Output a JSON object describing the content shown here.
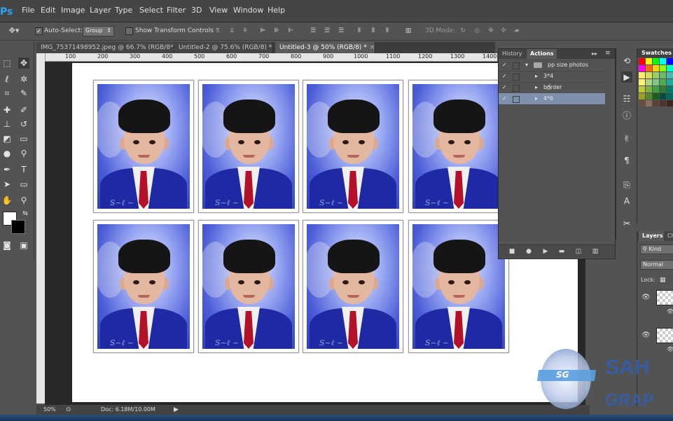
{
  "app": {
    "logo": "Ps"
  },
  "menu": [
    "File",
    "Edit",
    "Image",
    "Layer",
    "Type",
    "Select",
    "Filter",
    "3D",
    "View",
    "Window",
    "Help"
  ],
  "options": {
    "auto_select_label": "Auto-Select:",
    "auto_select_value": "Group",
    "show_transform_label": "Show Transform Controls",
    "mode_3d_label": "3D Mode:"
  },
  "tabs": [
    {
      "label": "IMG_75371498952.jpeg @ 66.7% (RGB/8*)"
    },
    {
      "label": "Untitled-2 @ 75.6% (RGB/8) *"
    },
    {
      "label": "Untitled-3 @ 50% (RGB/8) *"
    }
  ],
  "ruler": [
    "100",
    "200",
    "300",
    "400",
    "500",
    "600",
    "700",
    "800",
    "900",
    "1000",
    "1100",
    "1200",
    "1300",
    "1400"
  ],
  "panel": {
    "tabs": [
      "History",
      "Actions"
    ],
    "set_name": "pp size photos",
    "actions": [
      "3*4",
      "border",
      "4*6"
    ],
    "selected_index": 2
  },
  "swatches_title": "Swatches",
  "layers": {
    "tab": "Layers",
    "tab2": "Ch",
    "kind_label": "Kind",
    "blend": "Normal",
    "lock_label": "Lock:"
  },
  "status": {
    "zoom": "50%",
    "doc": "Doc: 6.18M/10.00M"
  },
  "watermark": {
    "badge": "SG",
    "line1": "SAH",
    "line2": "GRAP"
  },
  "colors": {
    "accent": "#2fa3f6",
    "selection": "#7f90ad"
  }
}
